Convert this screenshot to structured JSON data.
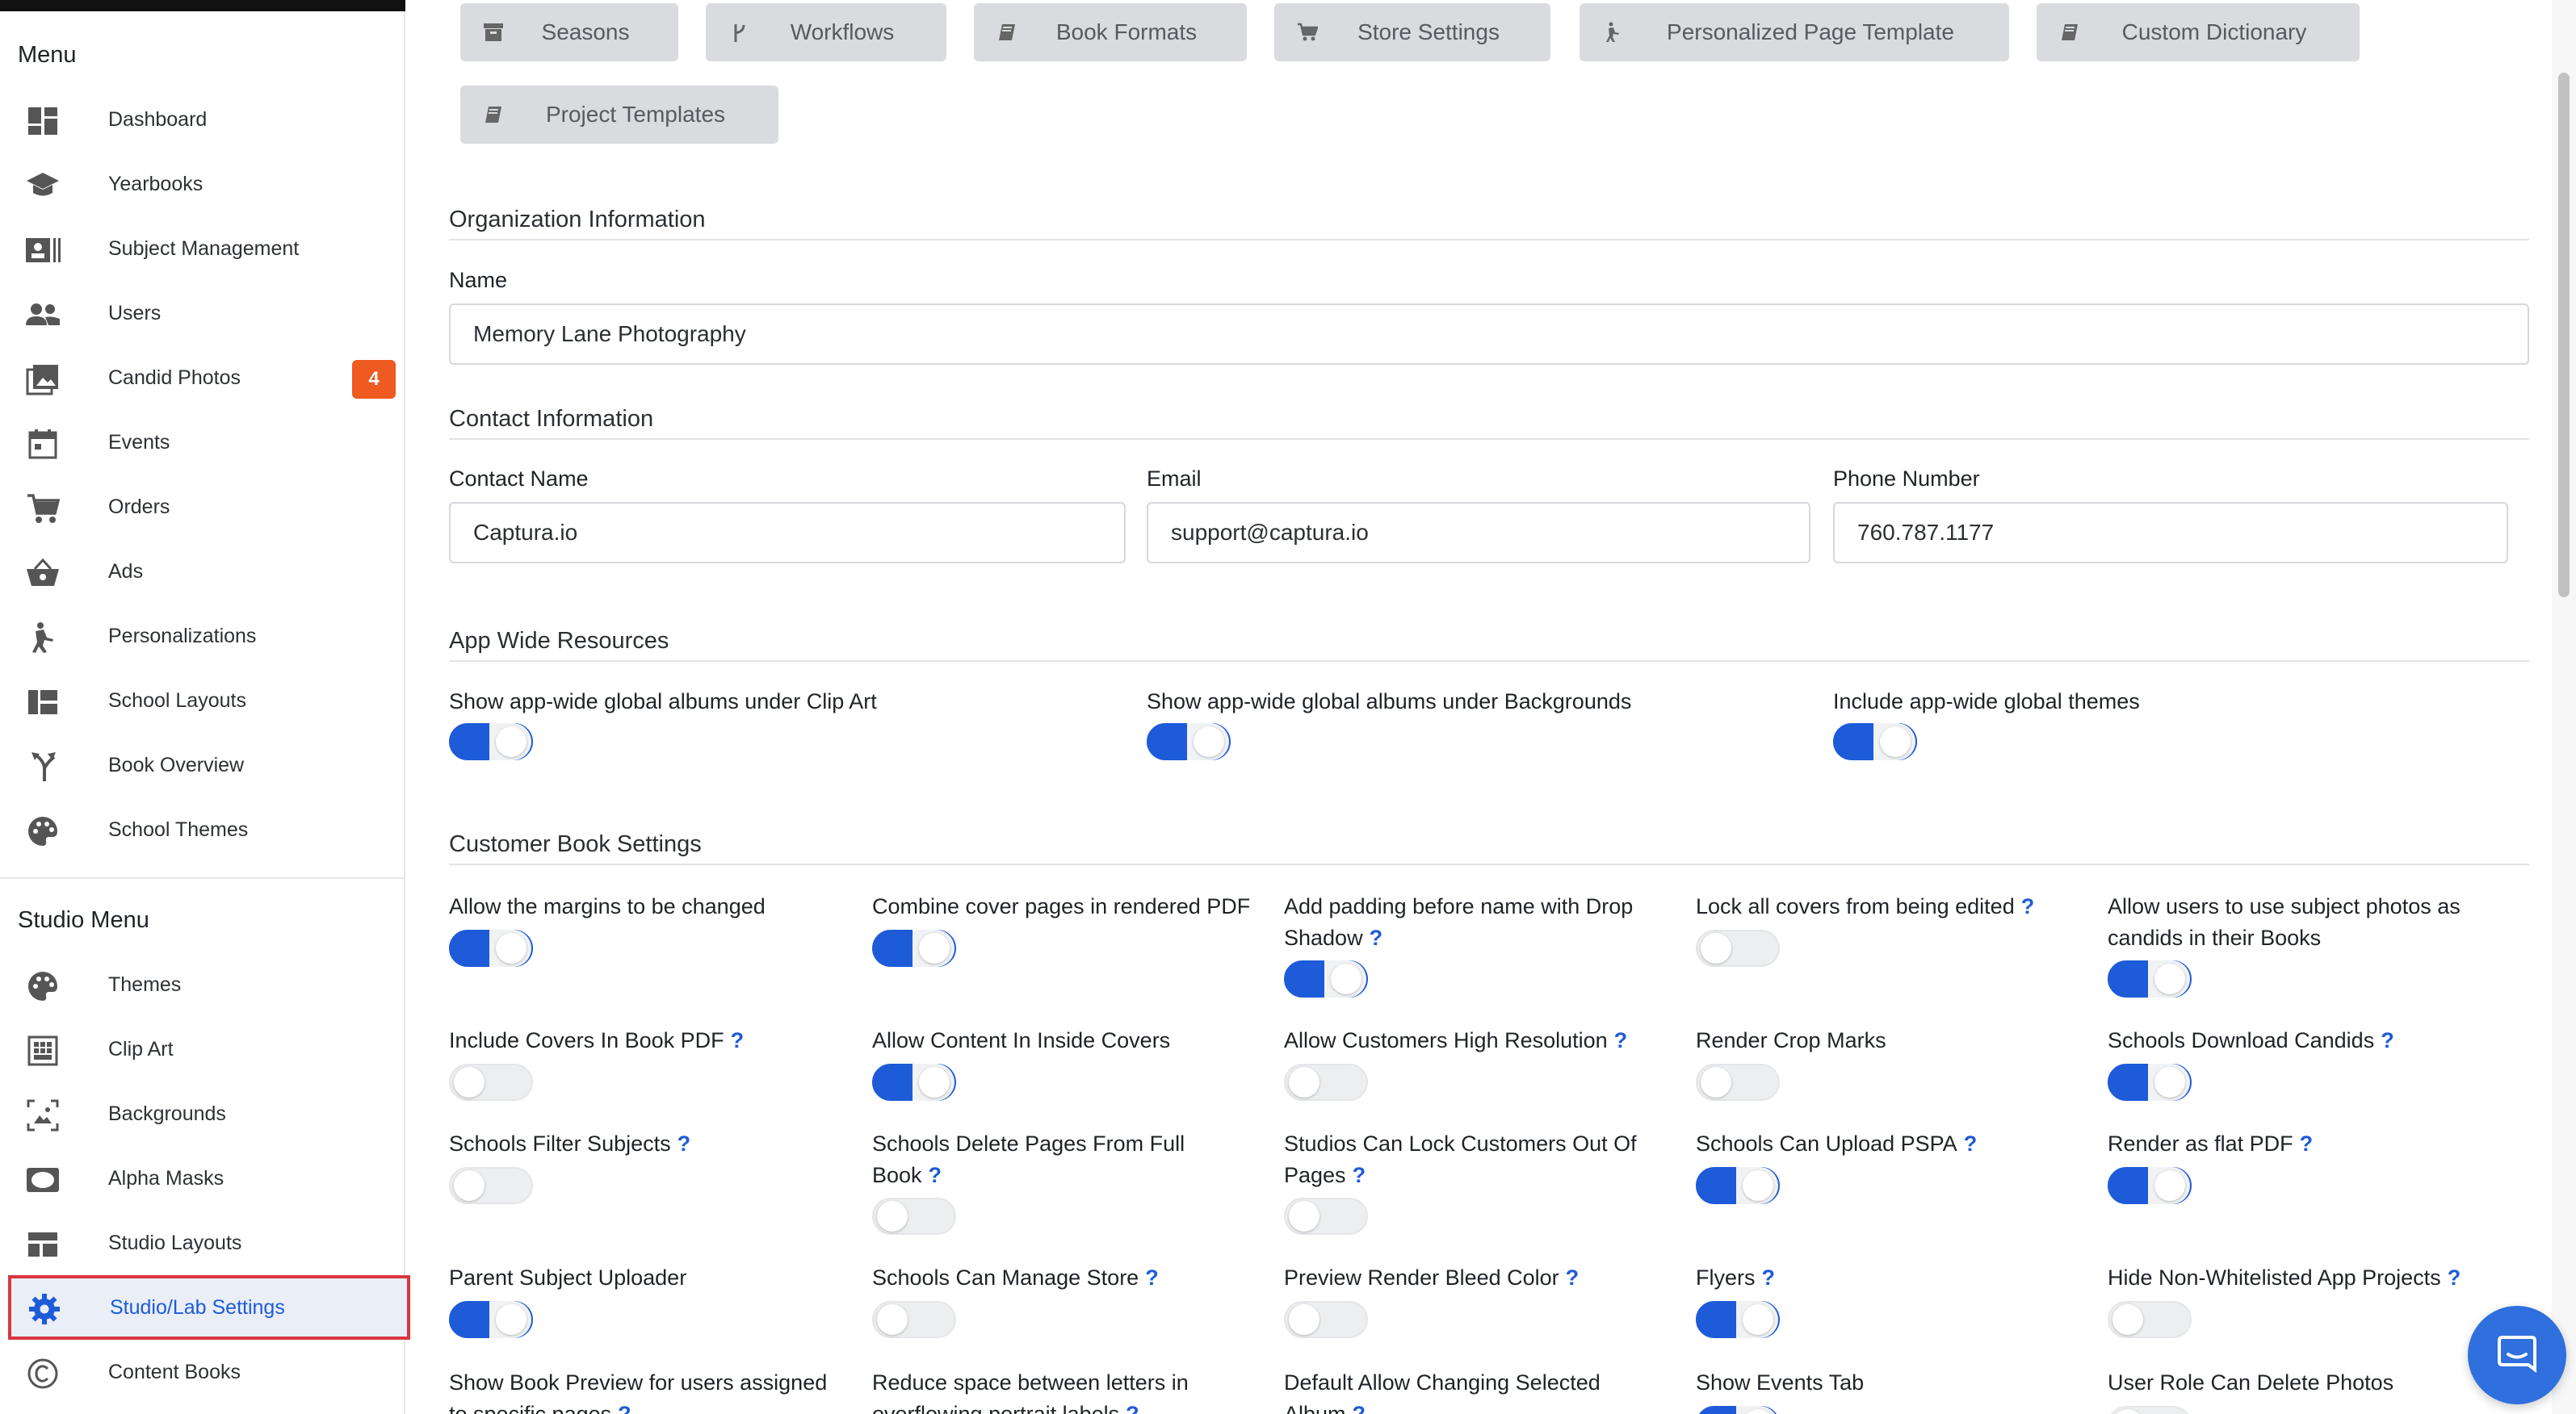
{
  "sidebar": {
    "menu_heading": "Menu",
    "items": [
      {
        "label": "Dashboard",
        "icon": "dashboard-icon"
      },
      {
        "label": "Yearbooks",
        "icon": "graduation-cap-icon"
      },
      {
        "label": "Subject Management",
        "icon": "id-card-icon"
      },
      {
        "label": "Users",
        "icon": "users-icon"
      },
      {
        "label": "Candid Photos",
        "icon": "photos-icon",
        "badge": "4"
      },
      {
        "label": "Events",
        "icon": "calendar-icon"
      },
      {
        "label": "Orders",
        "icon": "cart-icon"
      },
      {
        "label": "Ads",
        "icon": "basket-icon"
      },
      {
        "label": "Personalizations",
        "icon": "person-icon"
      },
      {
        "label": "School Layouts",
        "icon": "layout-icon"
      },
      {
        "label": "Book Overview",
        "icon": "fork-icon"
      },
      {
        "label": "School Themes",
        "icon": "palette-icon"
      }
    ],
    "studio_heading": "Studio Menu",
    "studio_items": [
      {
        "label": "Themes",
        "icon": "palette-icon"
      },
      {
        "label": "Clip Art",
        "icon": "grid-icon"
      },
      {
        "label": "Backgrounds",
        "icon": "image-frame-icon"
      },
      {
        "label": "Alpha Masks",
        "icon": "oval-mask-icon"
      },
      {
        "label": "Studio Layouts",
        "icon": "layout-icon"
      },
      {
        "label": "Studio/Lab Settings",
        "icon": "gear-icon",
        "active": true
      },
      {
        "label": "Content Books",
        "icon": "copyright-icon"
      }
    ]
  },
  "tabs": [
    {
      "label": "Seasons",
      "icon": "archive-icon"
    },
    {
      "label": "Workflows",
      "icon": "branch-icon"
    },
    {
      "label": "Book Formats",
      "icon": "book-icon"
    },
    {
      "label": "Store Settings",
      "icon": "cart-icon"
    },
    {
      "label": "Personalized Page Template",
      "icon": "person-icon"
    },
    {
      "label": "Custom Dictionary",
      "icon": "book-icon"
    },
    {
      "label": "Project Templates",
      "icon": "book-icon"
    }
  ],
  "organization": {
    "title": "Organization Information",
    "name_label": "Name",
    "name_value": "Memory Lane Photography"
  },
  "contact": {
    "title": "Contact Information",
    "contact_name_label": "Contact Name",
    "contact_name_value": "Captura.io",
    "email_label": "Email",
    "email_value": "support@captura.io",
    "phone_label": "Phone Number",
    "phone_value": "760.787.1177"
  },
  "app_wide": {
    "title": "App Wide Resources",
    "options": [
      {
        "label": "Show app-wide global albums under Clip Art",
        "on": true
      },
      {
        "label": "Show app-wide global albums under Backgrounds",
        "on": true
      },
      {
        "label": "Include app-wide global themes",
        "on": true
      }
    ]
  },
  "customer_book": {
    "title": "Customer Book Settings",
    "help_glyph": "?",
    "rows": [
      [
        {
          "label": "Allow the margins to be changed",
          "on": true,
          "help": false
        },
        {
          "label": "Combine cover pages in rendered PDF",
          "on": true,
          "help": false
        },
        {
          "label": "Add padding before name with Drop Shadow",
          "on": true,
          "help": true
        },
        {
          "label": "Lock all covers from being edited",
          "on": false,
          "help": true
        },
        {
          "label": "Allow users to use subject photos as candids in their Books",
          "on": true,
          "help": false
        }
      ],
      [
        {
          "label": "Include Covers In Book PDF",
          "on": false,
          "help": true
        },
        {
          "label": "Allow Content In Inside Covers",
          "on": true,
          "help": false
        },
        {
          "label": "Allow Customers High Resolution",
          "on": false,
          "help": true
        },
        {
          "label": "Render Crop Marks",
          "on": false,
          "help": false
        },
        {
          "label": "Schools Download Candids",
          "on": true,
          "help": true
        }
      ],
      [
        {
          "label": "Schools Filter Subjects",
          "on": false,
          "help": true
        },
        {
          "label": "Schools Delete Pages From Full Book",
          "on": false,
          "help": true
        },
        {
          "label": "Studios Can Lock Customers Out Of Pages",
          "on": false,
          "help": true
        },
        {
          "label": "Schools Can Upload PSPA",
          "on": true,
          "help": true
        },
        {
          "label": "Render as flat PDF",
          "on": true,
          "help": true
        }
      ],
      [
        {
          "label": "Parent Subject Uploader",
          "on": true,
          "help": false
        },
        {
          "label": "Schools Can Manage Store",
          "on": false,
          "help": true
        },
        {
          "label": "Preview Render Bleed Color",
          "on": false,
          "help": true
        },
        {
          "label": "Flyers",
          "on": true,
          "help": true
        },
        {
          "label": "Hide Non-Whitelisted App Projects",
          "on": false,
          "help": true
        }
      ],
      [
        {
          "label": "Show Book Preview for users assigned to specific pages",
          "on": false,
          "help": true
        },
        {
          "label": "Reduce space between letters in overflowing portrait labels",
          "on": false,
          "help": true
        },
        {
          "label": "Default Allow Changing Selected Album",
          "on": false,
          "help": true
        },
        {
          "label": "Show Events Tab",
          "on": true,
          "help": false
        },
        {
          "label": "User Role Can Delete Photos",
          "on": false,
          "help": false
        }
      ]
    ]
  },
  "colors": {
    "accent": "#1e5bd8",
    "badge": "#ee5a1f",
    "active_outline": "#d9363e"
  }
}
